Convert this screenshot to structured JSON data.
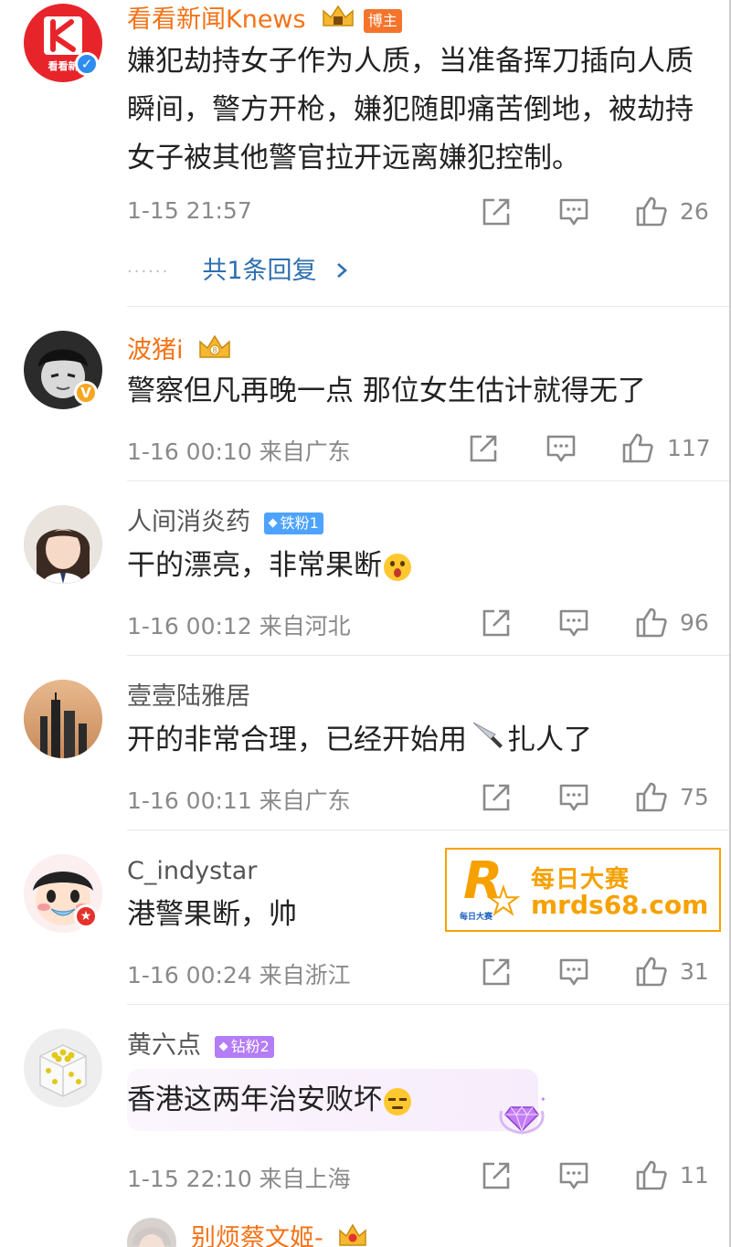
{
  "comments": [
    {
      "user": "看看新闻Knews",
      "avatar_text": "看看新",
      "role_badge": "博主",
      "text": "嫌犯劫持女子作为人质，当准备挥刀插向人质瞬间，警方开枪，嫌犯随即痛苦倒地，被劫持女子被其他警官拉开远离嫌犯控制。",
      "time": "1-15 21:57",
      "likes": "26",
      "replies": "共1条回复"
    },
    {
      "user": "波猪i",
      "text": "警察但凡再晚一点 那位女生估计就得无了",
      "time": "1-16 00:10 来自广东",
      "likes": "117"
    },
    {
      "user": "人间消炎药",
      "fan_badge": "铁粉1",
      "text": "干的漂亮，非常果断",
      "time": "1-16 00:12 来自河北",
      "likes": "96"
    },
    {
      "user": "壹壹陆雅居",
      "text_before": "开的非常合理，已经开始用",
      "text_after": "扎人了",
      "time": "1-16 00:11 来自广东",
      "likes": "75"
    },
    {
      "user": "C_indystar",
      "text": "港警果断，帅",
      "time": "1-16 00:24 来自浙江",
      "likes": "31"
    },
    {
      "user": "黄六点",
      "fan_badge": "钻粉2",
      "text": "香港这两年治安败坏",
      "time": "1-15 22:10 来自上海",
      "likes": "11"
    },
    {
      "user": "别烦蔡文姬-"
    }
  ],
  "watermark": {
    "title": "每日大赛",
    "url": "mrds68.com",
    "logo_letter": "R",
    "logo_small": "每日大赛"
  },
  "colors": {
    "orange_name": "#f47216",
    "reply_link": "#2f6fb1",
    "meta_gray": "#8a8a8a",
    "verified_blue": "#2d8cf0",
    "verified_gold": "#f5a623",
    "iron_fan": "#4da3ff",
    "diamond_fan": "#b47cf5",
    "ad_orange": "#f6a100",
    "ad_blue": "#1d5fbf"
  },
  "icons": [
    "share-icon",
    "comment-icon",
    "like-icon",
    "chevron-right-icon",
    "verified-icon",
    "crown-icon"
  ]
}
